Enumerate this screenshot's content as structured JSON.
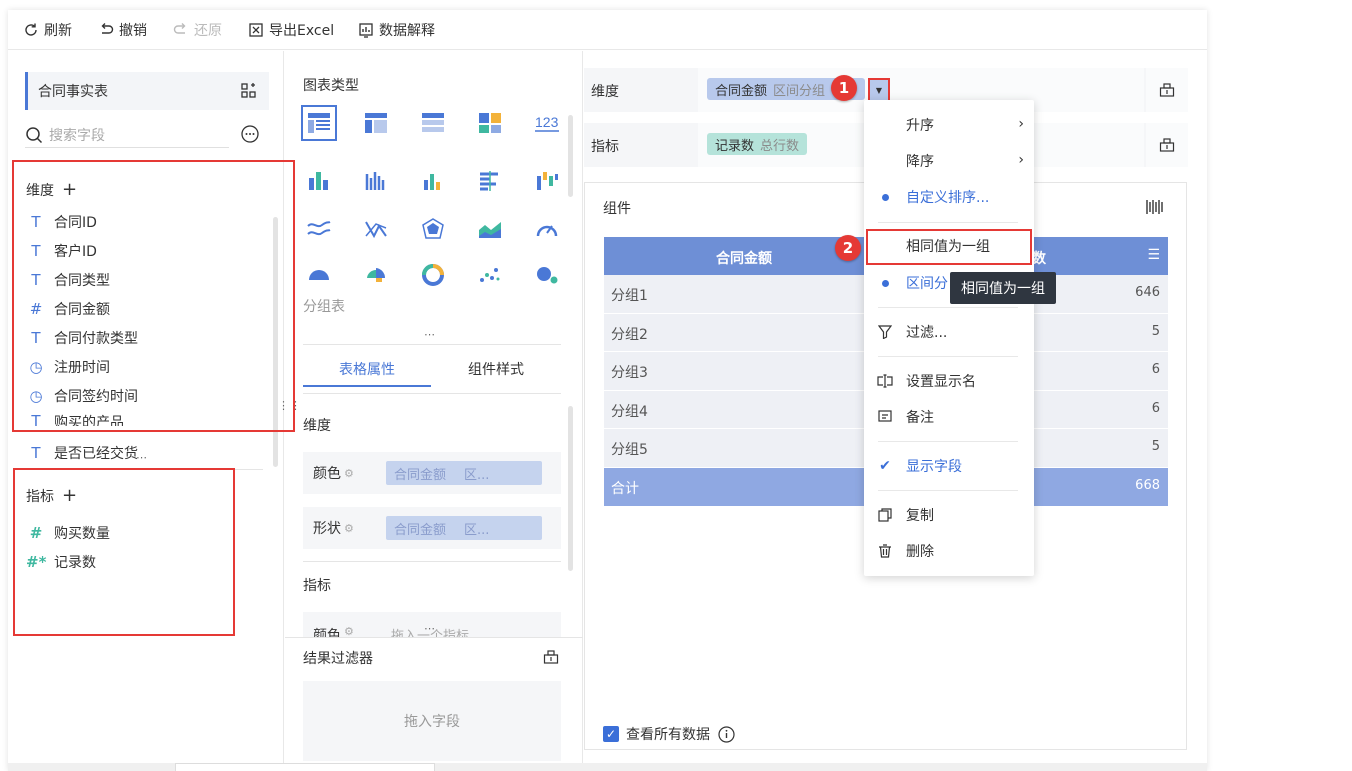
{
  "toolbar": {
    "refresh": "刷新",
    "undo": "撤销",
    "redo": "还原",
    "export_excel": "导出Excel",
    "explain_data": "数据解释"
  },
  "left": {
    "table_name": "合同事实表",
    "search_placeholder": "搜索字段",
    "dimension_title": "维度",
    "dimension_fields": [
      {
        "label": "合同ID",
        "icon": "text-type-icon"
      },
      {
        "label": "客户ID",
        "icon": "text-type-icon"
      },
      {
        "label": "合同类型",
        "icon": "text-type-icon"
      },
      {
        "label": "合同金额",
        "icon": "number-type-icon"
      },
      {
        "label": "合同付款类型",
        "icon": "text-type-icon"
      },
      {
        "label": "注册时间",
        "icon": "time-type-icon"
      },
      {
        "label": "合同签约时间",
        "icon": "time-type-icon"
      },
      {
        "label": "购买的产品",
        "icon": "text-type-icon"
      },
      {
        "label": "是否已经交货",
        "icon": "text-type-icon"
      }
    ],
    "measure_title": "指标",
    "measure_fields": [
      {
        "label": "购买数量",
        "icon": "number-type-icon"
      },
      {
        "label": "记录数",
        "icon": "record-count-icon"
      }
    ]
  },
  "middle": {
    "chart_type_title": "图表类型",
    "chart_type_name": "分组表",
    "tabs": [
      "表格属性",
      "组件样式"
    ],
    "dimension_section": "维度",
    "color_label": "颜色",
    "shape_label": "形状",
    "color_pill": "合同金额",
    "color_pill_sub": "区...",
    "shape_pill": "合同金额",
    "shape_pill_sub": "区...",
    "measure_section": "指标",
    "measure_color_label": "颜色",
    "measure_color_placeholder": "拖入一个指标",
    "result_filter_title": "结果过滤器",
    "drag_field_hint": "拖入字段"
  },
  "right": {
    "dimension_label": "维度",
    "dimension_pill": "合同金额",
    "dimension_pill_sub": "区间分组",
    "measure_label": "指标",
    "measure_pill": "记录数",
    "measure_pill_sub": "总行数",
    "component_title": "组件",
    "table_headers": [
      "合同金额",
      "数"
    ],
    "table_rows": [
      {
        "group": "分组1",
        "value": "646"
      },
      {
        "group": "分组2",
        "value": "5"
      },
      {
        "group": "分组3",
        "value": "6"
      },
      {
        "group": "分组4",
        "value": "6"
      },
      {
        "group": "分组5",
        "value": "5"
      }
    ],
    "total_label": "合计",
    "total_value": "668",
    "view_all_label": "查看所有数据"
  },
  "context_menu": {
    "ascending": "升序",
    "descending": "降序",
    "custom_sort": "自定义排序...",
    "same_value_group": "相同值为一组",
    "interval_group": "区间分",
    "filter": "过滤...",
    "set_display_name": "设置显示名",
    "note": "备注",
    "show_field": "显示字段",
    "copy": "复制",
    "delete": "删除"
  },
  "tooltip": "相同值为一组",
  "badges": [
    "1",
    "2"
  ],
  "colors": {
    "accent": "#4a78d6",
    "table_header": "#6e8fd6",
    "total_row": "#8fa8e2",
    "dimension_pill": "#b8c9ec",
    "measure_pill": "#b5e3da",
    "annotation_red": "#e53935"
  }
}
